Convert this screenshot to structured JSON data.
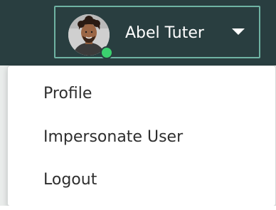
{
  "user_menu": {
    "user_name": "Abel Tuter",
    "presence_status": "online",
    "avatar_icon": "user-avatar-photo",
    "caret_icon": "chevron-down-icon",
    "accent_color": "#6fb3a3",
    "presence_color": "#3bd16f",
    "header_color": "#293e40"
  },
  "dropdown": {
    "items": [
      {
        "label": "Profile"
      },
      {
        "label": "Impersonate User"
      },
      {
        "label": "Logout"
      }
    ]
  }
}
